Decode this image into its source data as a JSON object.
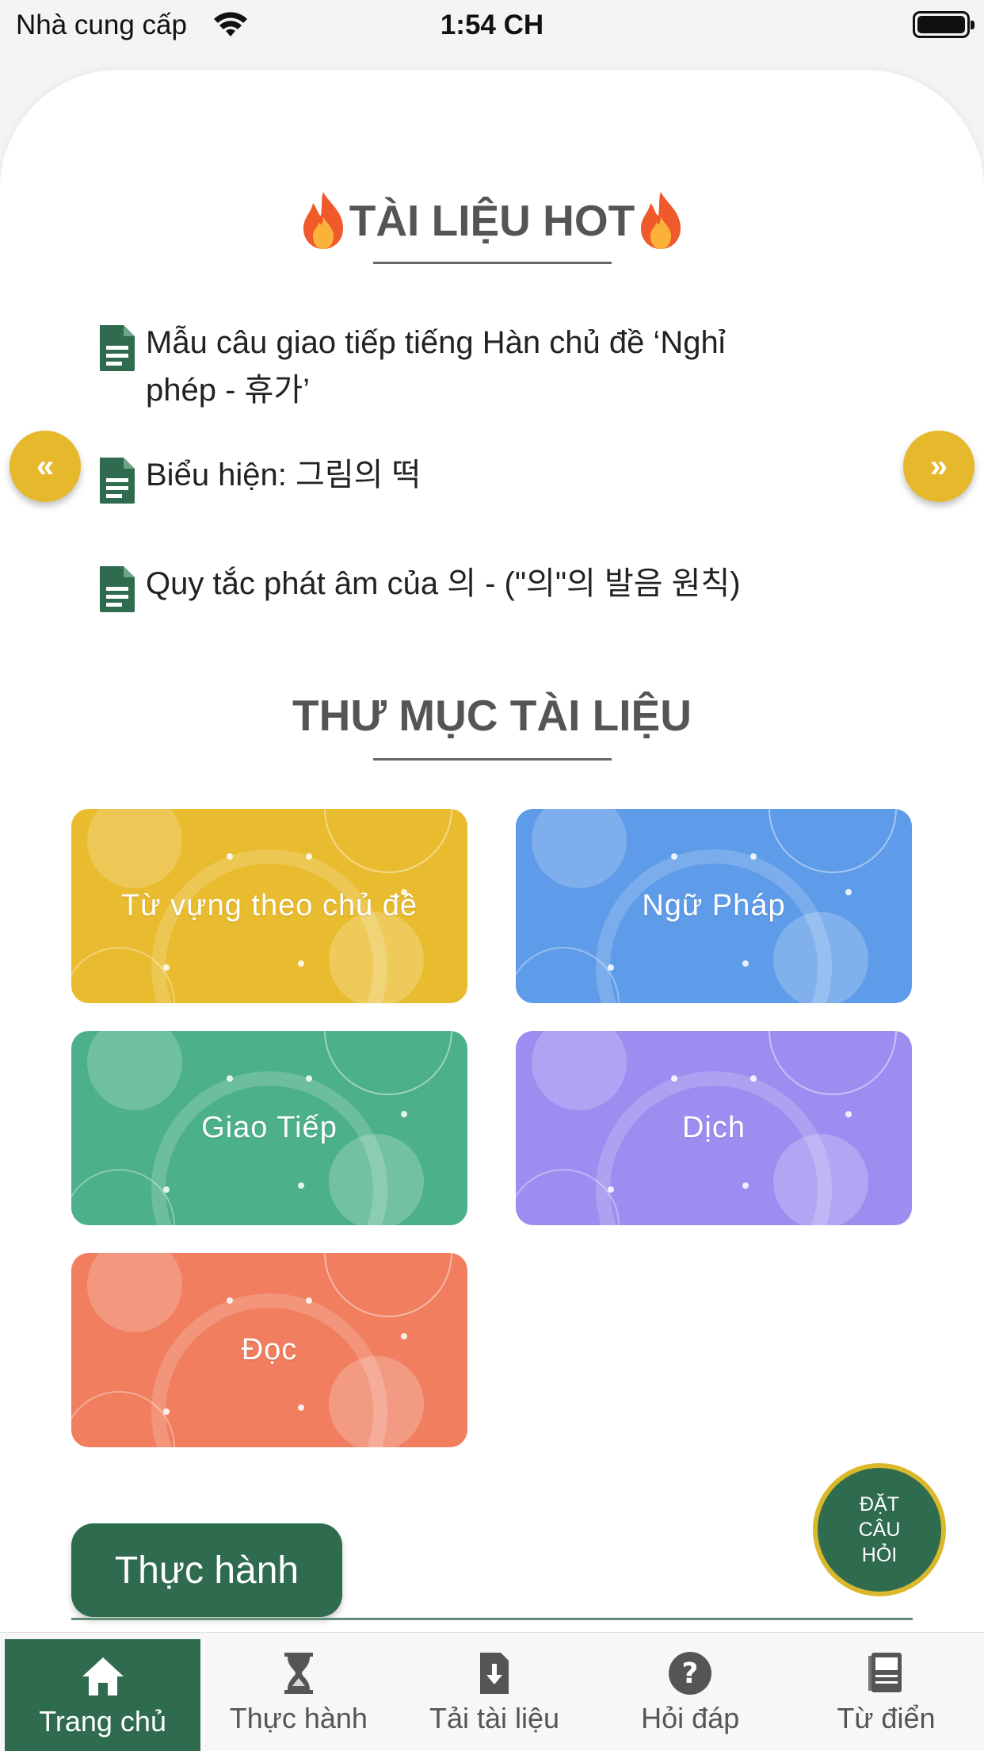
{
  "status_bar": {
    "carrier": "Nhà cung cấp",
    "time": "1:54 CH"
  },
  "hot": {
    "title": "TÀI LIỆU HOT",
    "items": [
      {
        "line1": "Mẫu câu giao tiếp tiếng Hàn chủ đề ‘Nghỉ",
        "line2": "phép - 휴가’"
      },
      {
        "line1": "Biểu hiện: 그림의 떡",
        "line2": ""
      },
      {
        "line1": "Quy tắc phát âm của 의 - (\"의\"의 발음 원칙)",
        "line2": ""
      }
    ],
    "prev_icon": "chevron-double-left-icon",
    "next_icon": "chevron-double-right-icon"
  },
  "folders": {
    "title": "THƯ MỤC TÀI LIỆU",
    "items": [
      {
        "label": "Từ vựng theo chủ đề",
        "color": "#e9bb2e"
      },
      {
        "label": "Ngữ Pháp",
        "color": "#5e9be8"
      },
      {
        "label": "Giao Tiếp",
        "color": "#4cb08a"
      },
      {
        "label": "Dịch",
        "color": "#9b8ef0"
      },
      {
        "label": "Đọc",
        "color": "#f07e5f"
      }
    ]
  },
  "practice": {
    "label": "Thực hành"
  },
  "ask": {
    "line1": "ĐẶT",
    "line2": "CÂU",
    "line3": "HỎI"
  },
  "bottom_nav": {
    "items": [
      {
        "label": "Trang chủ",
        "icon": "home-icon"
      },
      {
        "label": "Thực hành",
        "icon": "hourglass-icon"
      },
      {
        "label": "Tải tài liệu",
        "icon": "download-file-icon"
      },
      {
        "label": "Hỏi đáp",
        "icon": "question-icon"
      },
      {
        "label": "Từ điển",
        "icon": "dictionary-icon"
      }
    ]
  },
  "colors": {
    "primary": "#2f6b4f",
    "gold": "#e6b82c"
  }
}
